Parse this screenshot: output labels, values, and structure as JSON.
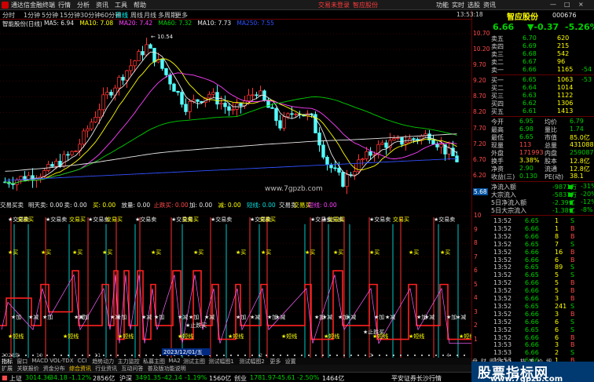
{
  "titlebar": {
    "app_title": "通达信金融终端",
    "menus": [
      "行情",
      "分析",
      "资讯",
      "工具",
      "帮助"
    ],
    "promo1": "交易未登录",
    "promo2": "智应股份",
    "right_menus": [
      "功能",
      "实时",
      "选股",
      "资讯"
    ],
    "win_buttons": [
      "—",
      "□",
      "×"
    ]
  },
  "toolbar": {
    "periods": [
      "分时",
      "1分钟",
      "5分钟",
      "15分钟",
      "30分钟",
      "60分钟",
      "日线",
      "周线",
      "月线",
      "多周期",
      "更多"
    ],
    "active_period": "日线"
  },
  "infobar": {
    "stock": "智能股份(日线)",
    "ma_items": [
      {
        "text": "MA5: 6.94",
        "color": "#e8e8e8"
      },
      {
        "text": "MA10: 7.08",
        "color": "#ffff00"
      },
      {
        "text": "MA20: 7.42",
        "color": "#ff40ff"
      },
      {
        "text": "MA60: 7.32",
        "color": "#00d000"
      },
      {
        "text": "MA10: 7.73",
        "color": "#e8e8e8"
      },
      {
        "text": "MA250: 7.55",
        "color": "#3050ff"
      }
    ]
  },
  "main_chart": {
    "y_ticks": [
      "10.70",
      "10.20",
      "9.70",
      "9.20",
      "8.70",
      "8.20",
      "7.70",
      "7.20",
      "6.70",
      "6.20",
      "5.70"
    ],
    "annotation_high": "10.54",
    "annotation_low": "5.68",
    "watermark": "www.7gpzb.com"
  },
  "indicator": {
    "name": "交易买卖",
    "params": [
      {
        "text": "明天卖: 0.00",
        "color": "#e8e8e8"
      },
      {
        "text": "卖: 0.00",
        "color": "#e8e8e8"
      },
      {
        "text": "买: 0.00",
        "color": "#ffff00"
      },
      {
        "text": "放量: 0.00",
        "color": "#e8e8e8"
      },
      {
        "text": "止跌买: 0.00",
        "color": "#ff4a4a"
      },
      {
        "text": "加: 0.00",
        "color": "#e8e8e8"
      },
      {
        "text": "减: 0.00",
        "color": "#ffff00"
      },
      {
        "text": "短线: 0.00",
        "color": "#00e0e0"
      },
      {
        "text": "交易卖",
        "color": "#e8e8e8"
      },
      {
        "text": "交易买",
        "color": "#ffff00"
      },
      {
        "text": "短线: 0.00",
        "color": "#ff40ff"
      }
    ],
    "y_ticks": [
      "10",
      "9",
      "8",
      "7",
      "6",
      "5",
      "4",
      "3",
      "2",
      "1"
    ],
    "labels": {
      "jiaoyimai": "交易卖",
      "jiaoyimai2": "交易买",
      "buy": "买",
      "add": "加",
      "reduce": "减",
      "short": "短线",
      "stop_buy": "止跌买"
    },
    "date_label": "2023/12/01/五",
    "year_labels": [
      "2023年",
      "10",
      "11",
      "2",
      "3",
      "4"
    ]
  },
  "tabs": {
    "row1": [
      "指标",
      "窗口",
      "MACD",
      "VOL-TDX",
      "CCI",
      "趋势动力",
      "主力监控",
      "私募主图",
      "MA2",
      "测试主图",
      "测试幅图1",
      "测试幅图2",
      "更多",
      "设置"
    ],
    "row2": [
      "扩展",
      "关联报价",
      "资金分布",
      "综合资讯",
      "行业资讯",
      "互动问答",
      "普及版功能说明"
    ]
  },
  "status": {
    "sh_label": "上证",
    "sh_val": "3014.36",
    "sh_chg": "-34.18",
    "sh_pct": "-1.12%",
    "sh_amt": "2856亿",
    "sz_label": "沪深",
    "sz_val": "3491.35",
    "sz_chg": "-42.14",
    "sz_pct": "-1.19%",
    "sz_amt": "1560亿",
    "cy_label": "创业",
    "cy_val": "1781.97",
    "cy_chg": "-45.61",
    "cy_pct": "-2.50%",
    "cy_amt": "1464亿",
    "broker": "平安证券长沙行情"
  },
  "rpanel": {
    "clock": "13:53:18",
    "stock_name": "智应股份",
    "code": "000676",
    "price": "6.66",
    "change": "▼-0.37",
    "change_pct": "-5.26%",
    "asks": [
      {
        "label": "卖五",
        "price": "6.70",
        "vol": "620",
        "delta": ""
      },
      {
        "label": "卖四",
        "price": "6.69",
        "vol": "215",
        "delta": ""
      },
      {
        "label": "卖三",
        "price": "6.68",
        "vol": "542",
        "delta": ""
      },
      {
        "label": "卖二",
        "price": "6.67",
        "vol": "96",
        "delta": ""
      },
      {
        "label": "卖一",
        "price": "6.66",
        "vol": "1165",
        "delta": "-54"
      }
    ],
    "bids": [
      {
        "label": "买一",
        "price": "6.65",
        "vol": "1063",
        "delta": "-53"
      },
      {
        "label": "买二",
        "price": "6.64",
        "vol": "1014",
        "delta": ""
      },
      {
        "label": "买三",
        "price": "6.63",
        "vol": "1122",
        "delta": ""
      },
      {
        "label": "买四",
        "price": "6.62",
        "vol": "1306",
        "delta": ""
      },
      {
        "label": "买五",
        "price": "6.61",
        "vol": "1413",
        "delta": ""
      }
    ],
    "stats": [
      {
        "l1": "今开",
        "v1": "6.95",
        "l2": "均价",
        "v2": "6.79"
      },
      {
        "l1": "最高",
        "v1": "6.98",
        "l2": "量比",
        "v2": "1.74"
      },
      {
        "l1": "最低",
        "v1": "6.65",
        "l2": "市值",
        "v2": "85.0亿"
      },
      {
        "l1": "现量",
        "v1": "113",
        "l2": "总量",
        "v2": "431088"
      },
      {
        "l1": "外盘",
        "v1": "171993",
        "l2": "内盘",
        "v2": "259087"
      },
      {
        "l1": "换手",
        "v1": "3.38%",
        "l2": "股本",
        "v2": "12.8亿"
      },
      {
        "l1": "净资",
        "v1": "2.90",
        "l2": "流通",
        "v2": "12.8亿"
      },
      {
        "l1": "收益(三)",
        "v1": "0.130",
        "l2": "PE(动)",
        "v2": "38.1"
      }
    ],
    "flows": [
      {
        "label": "净流入额",
        "val": "-9871万",
        "pct": "-31%"
      },
      {
        "label": "大宗流入",
        "val": "-5837万",
        "pct": "-20%"
      },
      {
        "label": "5日净流入额",
        "val": "-2.39亿",
        "pct": "-12%"
      },
      {
        "label": "5日大宗流入",
        "val": "-1.38亿",
        "pct": "-8%"
      }
    ],
    "ticks": [
      {
        "time": "13:52",
        "price": "6.65",
        "vol": "1",
        "bs": "S"
      },
      {
        "time": "13:52",
        "price": "6.66",
        "vol": "1",
        "bs": "B"
      },
      {
        "time": "13:52",
        "price": "6.66",
        "vol": "8",
        "bs": "B"
      },
      {
        "time": "13:52",
        "price": "6.65",
        "vol": "7",
        "bs": "S"
      },
      {
        "time": "13:52",
        "price": "6.66",
        "vol": "16",
        "bs": "B"
      },
      {
        "time": "13:52",
        "price": "6.66",
        "vol": "6",
        "bs": "B"
      },
      {
        "time": "13:52",
        "price": "6.65",
        "vol": "89",
        "bs": "S"
      },
      {
        "time": "13:52",
        "price": "6.65",
        "vol": "5",
        "bs": "S"
      },
      {
        "time": "13:52",
        "price": "6.66",
        "vol": "5",
        "bs": "B"
      },
      {
        "time": "13:52",
        "price": "6.66",
        "vol": "5",
        "bs": "B"
      },
      {
        "time": "13:52",
        "price": "6.66",
        "vol": "3",
        "bs": "B"
      },
      {
        "time": "13:52",
        "price": "6.65",
        "vol": "241",
        "bs": "S"
      },
      {
        "time": "13:52",
        "price": "6.66",
        "vol": "3",
        "bs": "B"
      },
      {
        "time": "13:52",
        "price": "6.66",
        "vol": "6",
        "bs": "S"
      },
      {
        "time": "13:52",
        "price": "6.65",
        "vol": "6",
        "bs": "S"
      },
      {
        "time": "13:52",
        "price": "6.66",
        "vol": "6",
        "bs": "B"
      },
      {
        "time": "13:53",
        "price": "6.66",
        "vol": "3",
        "bs": "B"
      },
      {
        "time": "13:53",
        "price": "6.66",
        "vol": "2",
        "bs": "S"
      },
      {
        "time": "13:53",
        "price": "6.66",
        "vol": "1",
        "bs": "B"
      },
      {
        "time": "13:53",
        "price": "6.65",
        "vol": "1",
        "bs": "S"
      }
    ],
    "bottom_tabs": [
      "盘",
      "财",
      "图文F10",
      "档",
      "笔",
      "价",
      "细"
    ]
  },
  "ad": {
    "title": "股票指标网",
    "url": "www.7gpzb.com"
  }
}
